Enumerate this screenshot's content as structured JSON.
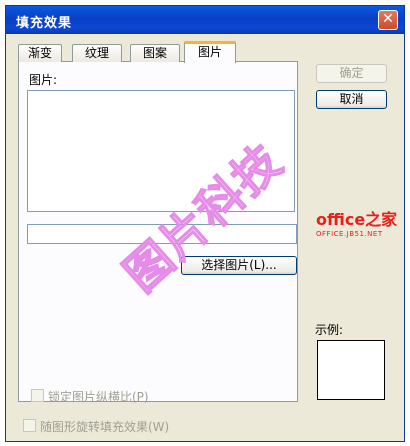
{
  "window": {
    "title": "填充效果",
    "close_glyph": "✕"
  },
  "tabs": [
    {
      "label": "渐变",
      "active": false
    },
    {
      "label": "纹理",
      "active": false
    },
    {
      "label": "图案",
      "active": false
    },
    {
      "label": "图片",
      "active": true
    }
  ],
  "panel": {
    "picture_label": "图片:",
    "select_button": "选择图片(L)...",
    "lock_aspect_label": "锁定图片纵横比(P)"
  },
  "buttons": {
    "ok": "确定",
    "cancel": "取消"
  },
  "sample_label": "示例:",
  "rotate_label": "随图形旋转填充效果(W)",
  "watermark": {
    "office": "office之家",
    "office_url": "OFFICE.JB51.NET",
    "text": "图片科技"
  }
}
